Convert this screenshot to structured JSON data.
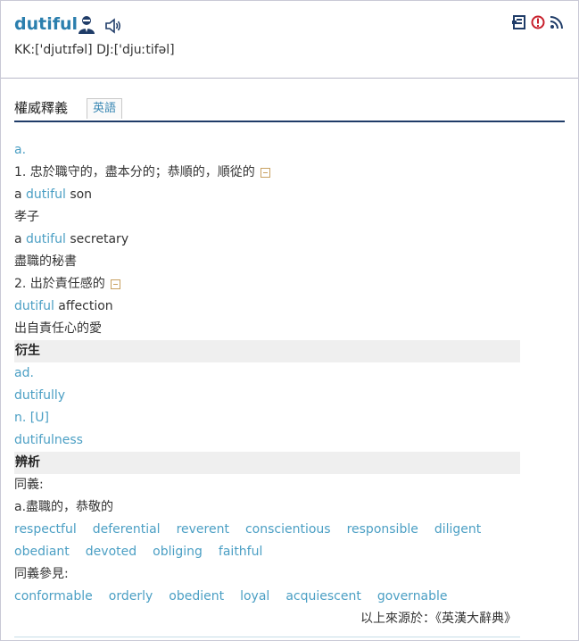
{
  "entry": {
    "word": "dutiful",
    "phonetic": "KK:['djutɪfəl] DJ:['djuːtifəl]"
  },
  "icons": {
    "user": "user-icon",
    "sound": "sound-icon",
    "bookmark": "bookmark-icon",
    "report": "alert-icon",
    "rss": "rss-icon"
  },
  "tabs": {
    "main": "權威釋義",
    "en": "英語"
  },
  "definitions": {
    "pos_a": "a.",
    "sense1": "1. 忠於職守的，盡本分的；恭順的，順從的",
    "ex1_pre": "a ",
    "ex1_hl": "dutiful",
    "ex1_post": " son",
    "ex1_tr": "孝子",
    "ex2_pre": "a ",
    "ex2_hl": "dutiful",
    "ex2_post": " secretary",
    "ex2_tr": "盡職的秘書",
    "sense2": "2. 出於責任感的",
    "ex3_hl": "dutiful",
    "ex3_post": " affection",
    "ex3_tr": "出自責任心的愛"
  },
  "derivatives": {
    "title": "衍生",
    "pos_ad": "ad.",
    "adverb": "dutifully",
    "pos_n": "n. [U]",
    "noun": "dutifulness"
  },
  "analysis": {
    "title": "辨析",
    "syn_label": "同義:",
    "syn_sense": "a.盡職的，恭敬的",
    "synonyms_row1": [
      "respectful",
      "deferential",
      "reverent",
      "conscientious",
      "responsible",
      "diligent"
    ],
    "synonyms_row2": [
      "obediant",
      "devoted",
      "obliging",
      "faithful"
    ],
    "see_also_label": "同義參見:",
    "see_also": [
      "conformable",
      "orderly",
      "obedient",
      "loyal",
      "acquiescent",
      "governable"
    ],
    "source": "以上來源於：《英漢大辭典》"
  }
}
